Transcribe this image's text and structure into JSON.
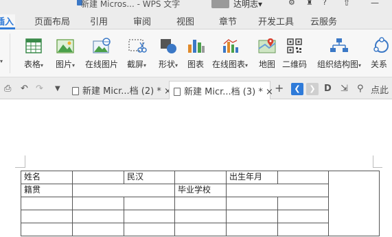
{
  "window": {
    "title": "新建 Micros... - WPS 文字",
    "user_name": "达明志",
    "user_dropdown": "▾"
  },
  "menu_tabs": [
    {
      "label": "插入",
      "active": true
    },
    {
      "label": "页面布局"
    },
    {
      "label": "引用"
    },
    {
      "label": "审阅"
    },
    {
      "label": "视图"
    },
    {
      "label": "章节"
    },
    {
      "label": "开发工具"
    },
    {
      "label": "云服务"
    }
  ],
  "ribbon": {
    "items": [
      {
        "label": "表格",
        "icon": "table-icon",
        "has_arrow": true
      },
      {
        "label": "图片",
        "icon": "picture-icon",
        "has_arrow": true
      },
      {
        "label": "在线图片",
        "icon": "online-picture-icon"
      },
      {
        "label": "截屏",
        "icon": "screenshot-icon",
        "has_arrow": true
      },
      {
        "label": "形状",
        "icon": "shapes-icon",
        "has_arrow": true
      },
      {
        "label": "图表",
        "icon": "chart-icon"
      },
      {
        "label": "在线图表",
        "icon": "online-chart-icon",
        "has_arrow": true
      },
      {
        "label": "地图",
        "icon": "map-icon"
      },
      {
        "label": "二维码",
        "icon": "qrcode-icon"
      },
      {
        "label": "组织结构图",
        "icon": "org-chart-icon",
        "has_arrow": true
      },
      {
        "label": "关系",
        "icon": "relation-icon"
      }
    ],
    "arrow": "▾"
  },
  "doc_tabs": [
    {
      "label": "新建 Micr...档 (2) *",
      "close": "×",
      "active": false
    },
    {
      "label": "新建 Micr...档 (3) *",
      "close": "×",
      "active": true
    }
  ],
  "doc_toolbar": {
    "add": "+",
    "right_text": "点此"
  },
  "table": {
    "rows": [
      [
        "姓名",
        "",
        "民汉",
        "",
        "出生年月",
        "",
        ""
      ],
      [
        "籍贯",
        "",
        "",
        "毕业学校",
        "",
        "",
        ""
      ],
      [
        "",
        "",
        "",
        "",
        "",
        "",
        ""
      ],
      [
        "",
        "",
        "",
        "",
        "",
        "",
        ""
      ],
      [
        "",
        "",
        "",
        "",
        "",
        "",
        ""
      ]
    ]
  },
  "colors": {
    "accent": "#2f7bd9",
    "ribbon_bg": "#f7f7f7",
    "tab_bg": "#ececec"
  }
}
